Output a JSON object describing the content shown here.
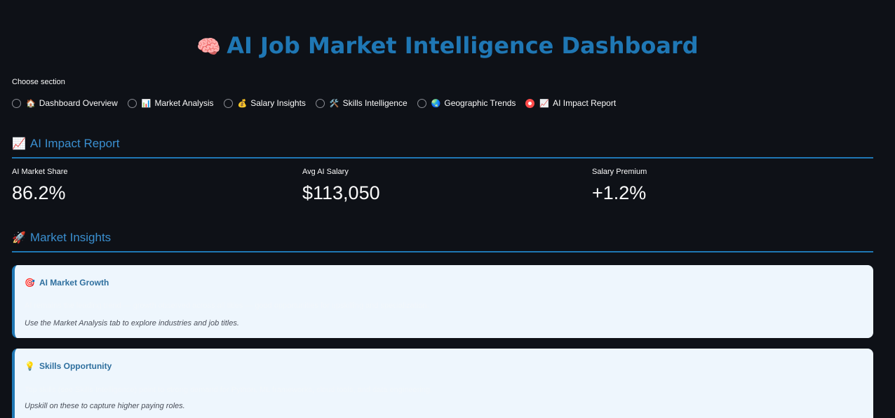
{
  "title": {
    "icon": "🧠",
    "text": "AI Job Market Intelligence Dashboard"
  },
  "section_chooser": {
    "label": "Choose section",
    "options": [
      {
        "icon": "🏠",
        "label": "Dashboard Overview",
        "selected": false
      },
      {
        "icon": "📊",
        "label": "Market Analysis",
        "selected": false
      },
      {
        "icon": "💰",
        "label": "Salary Insights",
        "selected": false
      },
      {
        "icon": "🛠️",
        "label": "Skills Intelligence",
        "selected": false
      },
      {
        "icon": "🌏",
        "label": "Geographic Trends",
        "selected": false
      },
      {
        "icon": "📈",
        "label": "AI Impact Report",
        "selected": true
      }
    ]
  },
  "impact_report": {
    "icon": "📈",
    "header": "AI Impact Report",
    "metrics": [
      {
        "label": "AI Market Share",
        "value": "86.2%"
      },
      {
        "label": "Avg AI Salary",
        "value": "$113,050"
      },
      {
        "label": "Salary Premium",
        "value": "+1.2%"
      }
    ]
  },
  "market_insights": {
    "icon": "🚀",
    "header": "Market Insights",
    "cards": [
      {
        "icon": "🎯",
        "title": "AI Market Growth",
        "body": "AI remains the leading trend — growth observed across all titles — good opportunities for upskilling and specialization.",
        "note": "Use the Market Analysis tab to explore industries and job titles."
      },
      {
        "icon": "💡",
        "title": "Skills Opportunity",
        "body": "Top skills (see Skills Intelligence) point to strong demand for Python, ML frameworks, cloud tools, and data engineering.",
        "note": "Upskill on these to capture higher paying roles."
      }
    ]
  },
  "colors": {
    "background": "#0e1117",
    "accent": "#1f77b4",
    "radio_selected": "#ff4b4b",
    "card_background": "#eef6fd"
  }
}
